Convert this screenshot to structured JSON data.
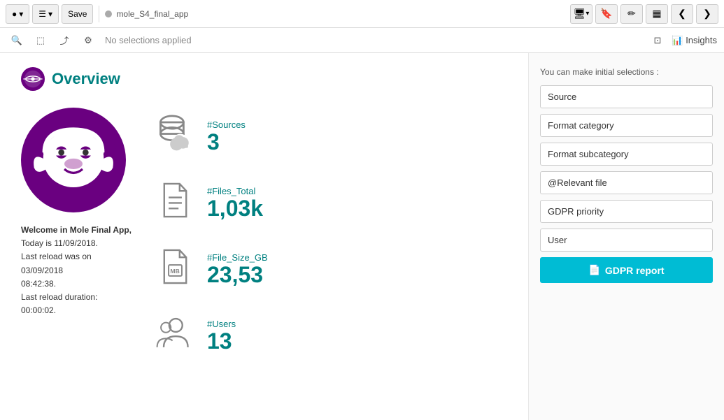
{
  "toolbar": {
    "back_icon": "◁",
    "forward_icon": "▷",
    "save_label": "Save",
    "app_name": "mole_S4_final_app",
    "screen_icon": "⊡",
    "bookmark_icon": "⚑",
    "edit_icon": "✎",
    "chart_icon": "▦",
    "nav_back": "❮",
    "nav_fwd": "❯"
  },
  "selections_bar": {
    "zoom_icon": "🔍",
    "select_icon": "⬚",
    "export_icon": "⤴",
    "settings_icon": "⚙",
    "label": "No selections applied",
    "smart_icon": "⊡",
    "insights_label": "Insights"
  },
  "page": {
    "title": "Overview"
  },
  "welcome": {
    "line1": "Welcome in Mole Final App,",
    "line2": "Today is 11/09/2018.",
    "line3": "Last reload was on 03/09/2018",
    "line4": "08:42:38.",
    "line5": "Last reload duration: 00:00:02."
  },
  "stats": [
    {
      "label": "#Sources",
      "value": "3",
      "icon": "sources"
    },
    {
      "label": "#Files_Total",
      "value": "1,03k",
      "icon": "files"
    },
    {
      "label": "#File_Size_GB",
      "value": "23,53",
      "icon": "filesize"
    },
    {
      "label": "#Users",
      "value": "13",
      "icon": "users"
    }
  ],
  "right_panel": {
    "hint": "You can make initial selections :",
    "filters": [
      "Source",
      "Format category",
      "Format subcategory",
      "@Relevant file",
      "GDPR priority",
      "User"
    ],
    "gdpr_btn": "GDPR report"
  }
}
